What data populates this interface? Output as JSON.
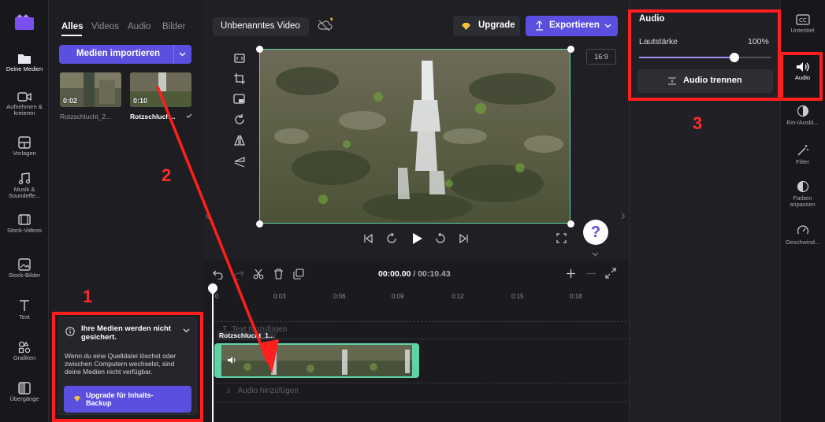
{
  "left_rail": {
    "items": [
      {
        "label": "Deine Medien",
        "icon": "folder-icon"
      },
      {
        "label": "Aufnehmen & kreieren",
        "icon": "camera-icon"
      },
      {
        "label": "Vorlagen",
        "icon": "templates-icon"
      },
      {
        "label": "Musik & Soundeffe...",
        "icon": "music-icon"
      },
      {
        "label": "Stock-Videos",
        "icon": "film-icon"
      },
      {
        "label": "Stock-Bilder",
        "icon": "image-icon"
      },
      {
        "label": "Text",
        "icon": "text-icon"
      },
      {
        "label": "Grafiken",
        "icon": "shapes-icon"
      },
      {
        "label": "Übergänge",
        "icon": "transition-icon"
      }
    ]
  },
  "media": {
    "tabs": [
      "Alles",
      "Videos",
      "Audio",
      "Bilder"
    ],
    "import_label": "Medien importieren",
    "clips": [
      {
        "duration": "0:02",
        "label": "Rotzschlucht_2..."
      },
      {
        "duration": "0:10",
        "label": "Rotzschluch..."
      }
    ],
    "notice": {
      "title": "Ihre Medien werden nicht gesichert.",
      "body": "Wenn du eine Quelldatei löschst oder zwischen Computern wechselst, sind deine Medien nicht verfügbar.",
      "button": "Upgrade für Inhalts-Backup"
    }
  },
  "header": {
    "project_title": "Unbenanntes Video",
    "upgrade_label": "Upgrade",
    "export_label": "Exportieren",
    "aspect_ratio": "16:9"
  },
  "playback": {
    "current_time": "00:00.00",
    "separator": " / ",
    "total_time": "00:10.43"
  },
  "timeline": {
    "ticks": [
      "0",
      "0:03",
      "0:06",
      "0:09",
      "0:12",
      "0:15",
      "0:18"
    ],
    "clip_label": "Rotzschlucht_1...",
    "text_placeholder": "Text hinzufügen",
    "audio_placeholder": "Audio hinzufügen"
  },
  "audio_panel": {
    "title": "Audio",
    "volume_label": "Lautstärke",
    "volume_value": "100%",
    "volume_fraction": 0.72,
    "detach_label": "Audio trennen"
  },
  "right_rail": {
    "items": [
      {
        "label": "Untertitel",
        "icon": "captions-icon"
      },
      {
        "label": "Audio",
        "icon": "speaker-icon"
      },
      {
        "label": "Ein-/Ausbl...",
        "icon": "fade-icon"
      },
      {
        "label": "Filter",
        "icon": "filter-wand-icon"
      },
      {
        "label": "Farben anpassen",
        "icon": "color-adjust-icon"
      },
      {
        "label": "Geschwind...",
        "icon": "speed-icon"
      }
    ]
  },
  "annotations": {
    "n1": "1",
    "n2": "2",
    "n3": "3"
  },
  "colors": {
    "accent": "#5b4fe0",
    "selection": "#5fd3a6",
    "annotation": "#ff1f1f"
  }
}
